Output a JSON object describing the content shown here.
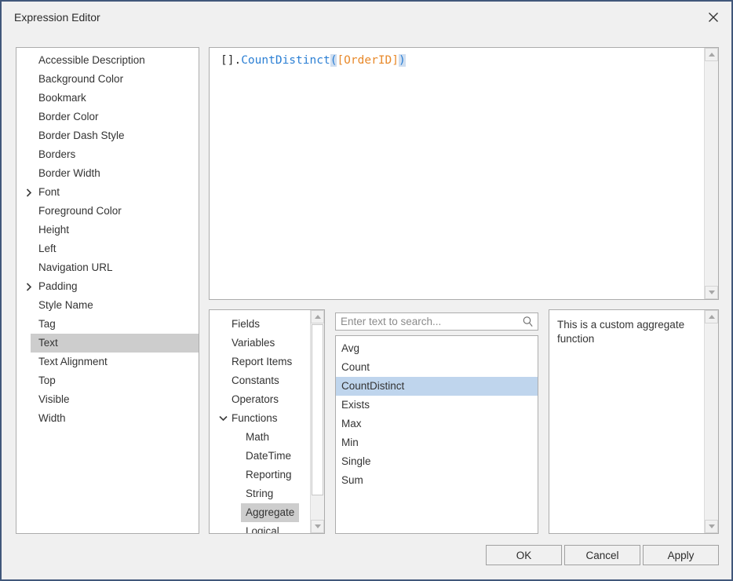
{
  "window": {
    "title": "Expression Editor",
    "close_icon": "close-icon",
    "border_color": "#41577a",
    "background": "#f0f0f0"
  },
  "properties_list": {
    "selected": "Text",
    "items": [
      {
        "label": "Accessible Description",
        "expandable": false
      },
      {
        "label": "Background Color",
        "expandable": false
      },
      {
        "label": "Bookmark",
        "expandable": false
      },
      {
        "label": "Border Color",
        "expandable": false
      },
      {
        "label": "Border Dash Style",
        "expandable": false
      },
      {
        "label": "Borders",
        "expandable": false
      },
      {
        "label": "Border Width",
        "expandable": false
      },
      {
        "label": "Font",
        "expandable": true
      },
      {
        "label": "Foreground Color",
        "expandable": false
      },
      {
        "label": "Height",
        "expandable": false
      },
      {
        "label": "Left",
        "expandable": false
      },
      {
        "label": "Navigation URL",
        "expandable": false
      },
      {
        "label": "Padding",
        "expandable": true
      },
      {
        "label": "Style Name",
        "expandable": false
      },
      {
        "label": "Tag",
        "expandable": false
      },
      {
        "label": "Text",
        "expandable": false
      },
      {
        "label": "Text Alignment",
        "expandable": false
      },
      {
        "label": "Top",
        "expandable": false
      },
      {
        "label": "Visible",
        "expandable": false
      },
      {
        "label": "Width",
        "expandable": false
      }
    ]
  },
  "expression": {
    "full_text": "[].CountDistinct([OrderID])",
    "tokens": [
      {
        "text": "[].",
        "kind": "plain"
      },
      {
        "text": "CountDistinct",
        "kind": "function"
      },
      {
        "text": "(",
        "kind": "paren-selected"
      },
      {
        "text": "[OrderID]",
        "kind": "field"
      },
      {
        "text": ")",
        "kind": "paren-selected"
      }
    ],
    "colors": {
      "function": "#2b7fd4",
      "field": "#e8892a",
      "paren": "#2b7fd4",
      "selection_background": "#cfdef0",
      "plain": "#2b2b2b"
    }
  },
  "category_tree": {
    "selected": "Aggregate",
    "items": [
      {
        "label": "Fields",
        "level": 0,
        "chevron": ""
      },
      {
        "label": "Variables",
        "level": 0,
        "chevron": ""
      },
      {
        "label": "Report Items",
        "level": 0,
        "chevron": ""
      },
      {
        "label": "Constants",
        "level": 0,
        "chevron": ""
      },
      {
        "label": "Operators",
        "level": 0,
        "chevron": ""
      },
      {
        "label": "Functions",
        "level": 0,
        "chevron": "chevron-down-icon"
      },
      {
        "label": "Math",
        "level": 1,
        "chevron": ""
      },
      {
        "label": "DateTime",
        "level": 1,
        "chevron": ""
      },
      {
        "label": "Reporting",
        "level": 1,
        "chevron": ""
      },
      {
        "label": "String",
        "level": 1,
        "chevron": ""
      },
      {
        "label": "Aggregate",
        "level": 1,
        "chevron": ""
      },
      {
        "label": "Logical",
        "level": 1,
        "chevron": ""
      }
    ]
  },
  "search": {
    "value": "",
    "placeholder": "Enter text to search...",
    "icon": "search-icon"
  },
  "function_list": {
    "selected": "CountDistinct",
    "items": [
      {
        "label": "Avg"
      },
      {
        "label": "Count"
      },
      {
        "label": "CountDistinct"
      },
      {
        "label": "Exists"
      },
      {
        "label": "Max"
      },
      {
        "label": "Min"
      },
      {
        "label": "Single"
      },
      {
        "label": "Sum"
      }
    ],
    "selection_color": "#bfd5ed"
  },
  "description": {
    "text": "This is a custom aggregate function"
  },
  "buttons": {
    "ok": "OK",
    "cancel": "Cancel",
    "apply": "Apply"
  }
}
